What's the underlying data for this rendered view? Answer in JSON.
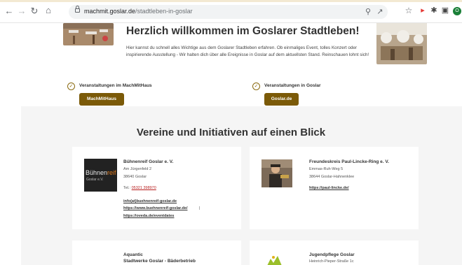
{
  "browser": {
    "url_domain": "machmit.goslar.de",
    "url_path": "/stadtleben-in-goslar",
    "profile_initial": "O",
    "icons": [
      "back-arrow-icon",
      "forward-arrow-icon",
      "reload-icon",
      "home-icon",
      "lock-icon",
      "zoom-icon",
      "share-icon",
      "bookmark-star-icon",
      "extension-megaphone-icon",
      "extensions-puzzle-icon",
      "side-panel-icon",
      "profile-avatar-icon"
    ]
  },
  "hero": {
    "title": "Herzlich willkommen im Goslarer Stadtleben!",
    "text": "Hier kannst du schnell alles Wichtige aus dem Goslarer Stadtleben erfahren. Ob einmaliges Event, tolles Konzert oder inspirierende Ausstellung - Wir halten dich über alle Ereignisse in Goslar auf dem aktuellsten Stand. Reinschauen lohnt sich!"
  },
  "events": [
    {
      "label": "Veranstaltungen im MachMitHaus",
      "button": "MachMitHaus"
    },
    {
      "label": "Veranstaltungen in Goslar",
      "button": "Goslar.de"
    }
  ],
  "section_title": "Vereine und Initiativen auf einen Blick",
  "cards": [
    {
      "name": "Bühnenreif Goslar e. V.",
      "street": "Am Jürgenfeld 2",
      "city": "38640 Goslar",
      "tel_prefix": "Tel.:",
      "tel": "05321 398970",
      "links": [
        "info(at)buehnenreif-goslar.de",
        "https://www.buehnenreif-goslar.de/",
        "https://oveda.de/eventdates"
      ],
      "link_sep": "|",
      "logo_text_a": "Bühnen",
      "logo_text_b": "reif",
      "logo_sub": "Goslar e.V."
    },
    {
      "name": "Freundeskreis Paul-Lincke-Ring e. V.",
      "street": "Emmas-Ruh-Weg 5",
      "city": "38644 Goslar-Hahnenklee",
      "links": [
        "https://paul-lincke.de/"
      ]
    },
    {
      "name": "Aquantic",
      "street": "Stadtwerke Goslar - Bäderbetrieb"
    },
    {
      "name": "Jugendpflege Goslar",
      "street": "Heinrich-Pieper-Straße 1c"
    }
  ],
  "colors": {
    "accent": "#7b5a08",
    "page_gray": "#f5f5f5",
    "tel_red": "#b71c1c"
  }
}
